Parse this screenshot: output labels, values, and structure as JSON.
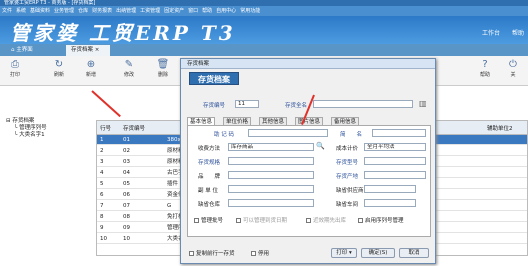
{
  "app": {
    "titlebar": "管家婆工贸ERP T3 - 商务版 - [存货档案]",
    "menu": [
      "文件",
      "系统",
      "基础资料",
      "业务管理",
      "仓库",
      "财务报表",
      "出纳管理",
      "工资管理",
      "固定资产",
      "窗口",
      "帮助",
      "自用中心",
      "常用功能"
    ],
    "logo": "管家婆 工贸ERP T3",
    "right_links": [
      "工作台",
      "帮助"
    ]
  },
  "tabs": {
    "home": "主界面",
    "active": "存货档案"
  },
  "toolbar": {
    "items": [
      {
        "label": "打印",
        "icon": "printer-icon",
        "glyph": "⎙"
      },
      {
        "label": "刷新",
        "icon": "refresh-icon",
        "glyph": "↻"
      },
      {
        "label": "新增",
        "icon": "add-icon",
        "glyph": "⊕"
      },
      {
        "label": "修改",
        "icon": "edit-icon",
        "glyph": "✎"
      },
      {
        "label": "删除",
        "icon": "delete-icon",
        "glyph": "🗑"
      },
      {
        "label": "帮助",
        "icon": "help-icon",
        "glyph": "?"
      },
      {
        "label": "关",
        "icon": "close-icon",
        "glyph": "⏻"
      }
    ]
  },
  "tree": {
    "root": "存货档案",
    "children": [
      "管理序列号",
      "大类名字1"
    ]
  },
  "grid": {
    "headers": {
      "no": "行号",
      "code": "存货编号",
      "unit": "辅助单位2"
    },
    "rows": [
      {
        "no": "1",
        "code": "01",
        "name": "380x480"
      },
      {
        "no": "2",
        "code": "02",
        "name": "原材料"
      },
      {
        "no": "3",
        "code": "03",
        "name": "原材料"
      },
      {
        "no": "4",
        "code": "04",
        "name": "古巴手册"
      },
      {
        "no": "5",
        "code": "05",
        "name": "插件"
      },
      {
        "no": "6",
        "code": "06",
        "name": "资金件"
      },
      {
        "no": "7",
        "code": "07",
        "name": "G"
      },
      {
        "no": "8",
        "code": "08",
        "name": "免打板"
      },
      {
        "no": "9",
        "code": "09",
        "name": "管理序列号"
      },
      {
        "no": "10",
        "code": "10",
        "name": "大类名字1"
      }
    ]
  },
  "dialog": {
    "title": "存货档案",
    "header": "存货档案",
    "code_label": "存货编号",
    "code_value": "11",
    "fullname_label": "存货全名",
    "tabs": [
      "基本信息",
      "单位价格",
      "其他信息",
      "图片信息",
      "备用信息"
    ],
    "fields": {
      "shortname": "助 记 码",
      "shortname2": "简　　名",
      "category": "收费方法",
      "category_value": "库存商品",
      "cost": "成本计价",
      "cost_value": "全月平均法",
      "spec": "存货规格",
      "model": "存货型号",
      "origin": "品　　牌",
      "area": "存货产地",
      "unit": "副 单 位",
      "default_supplier": "缺省供应商",
      "default_warehouse": "缺省仓库",
      "default_store": "缺省车间"
    },
    "checks": [
      "管理批号",
      "可以管理到货日期",
      "近效期先出库",
      "启用序列号管理"
    ],
    "bottom_checks": [
      "复制前行一存货",
      "停用"
    ],
    "buttons": {
      "print": "打印",
      "ok": "确定(S)",
      "cancel": "取消"
    }
  },
  "colors": {
    "brand": "#2f6fb0",
    "arrow": "#e0312a"
  }
}
